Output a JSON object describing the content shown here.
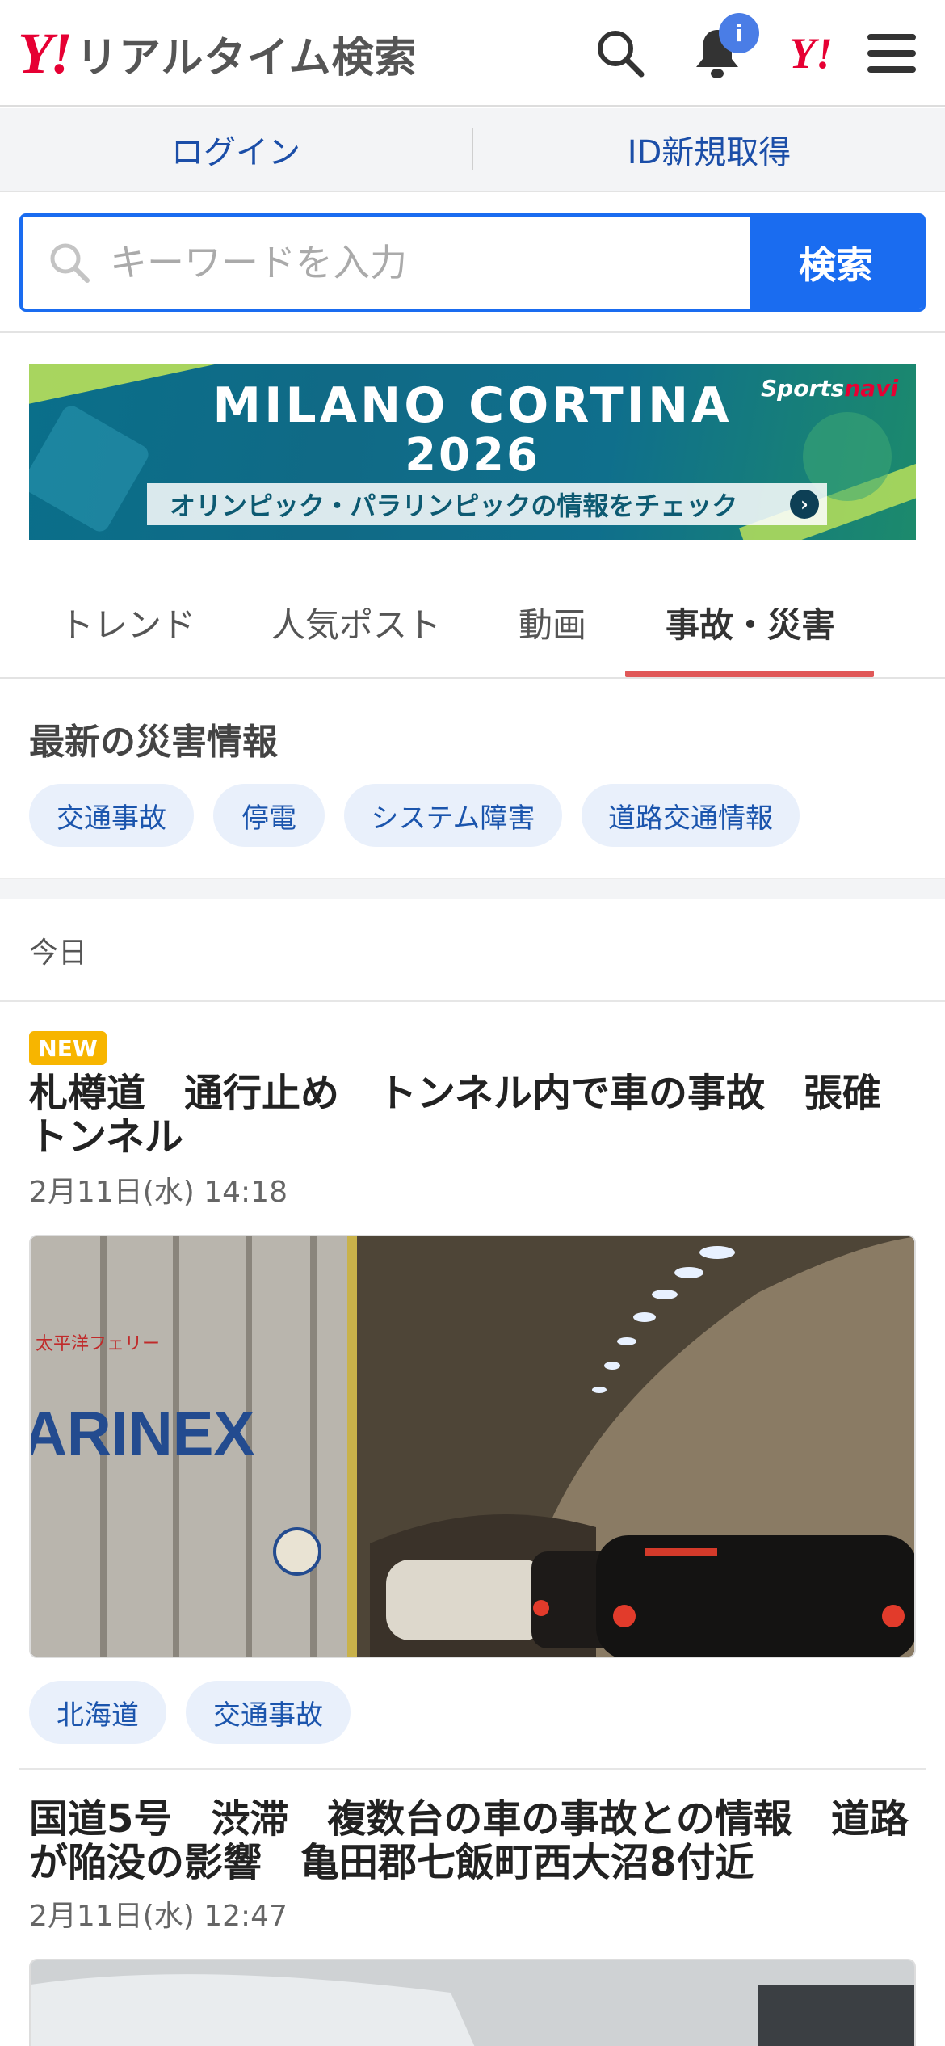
{
  "header": {
    "logo_mark": "Y!",
    "logo_text": "リアルタイム検索",
    "notification_badge": "i",
    "yahoo_mark": "Y!"
  },
  "account": {
    "login": "ログイン",
    "signup": "ID新規取得"
  },
  "search": {
    "placeholder": "キーワードを入力",
    "button": "検索"
  },
  "banner": {
    "title": "MILANO CORTINA",
    "year": "2026",
    "subtitle": "オリンピック・パラリンピックの情報をチェック",
    "brand_part1": "Sports",
    "brand_part2": "navi"
  },
  "tabs": [
    {
      "label": "トレンド",
      "active": false
    },
    {
      "label": "人気ポスト",
      "active": false
    },
    {
      "label": "動画",
      "active": false
    },
    {
      "label": "事故・災害",
      "active": true
    }
  ],
  "disaster": {
    "title": "最新の災害情報",
    "chips": [
      "交通事故",
      "停電",
      "システム障害",
      "道路交通情報"
    ]
  },
  "date_group": "今日",
  "articles": [
    {
      "badge": "NEW",
      "title": "札樽道　通行止め　トンネル内で車の事故　張碓トンネル",
      "date": "2月11日(水) 14:18",
      "truck_text": "ARINEX",
      "ferry_text": "太平洋フェリー",
      "tags": [
        "北海道",
        "交通事故"
      ]
    },
    {
      "title": "国道5号　渋滞　複数台の車の事故との情報　道路が陥没の影響　亀田郡七飯町西大沼8付近",
      "date": "2月11日(水) 12:47"
    }
  ],
  "colors": {
    "accent_blue": "#1a6cf0",
    "yahoo_red": "#e60033",
    "tab_underline": "#e05858",
    "chip_bg": "#e9f0fb",
    "new_badge": "#f7b500"
  },
  "icons": [
    "search-icon",
    "bell-icon",
    "menu-icon"
  ]
}
